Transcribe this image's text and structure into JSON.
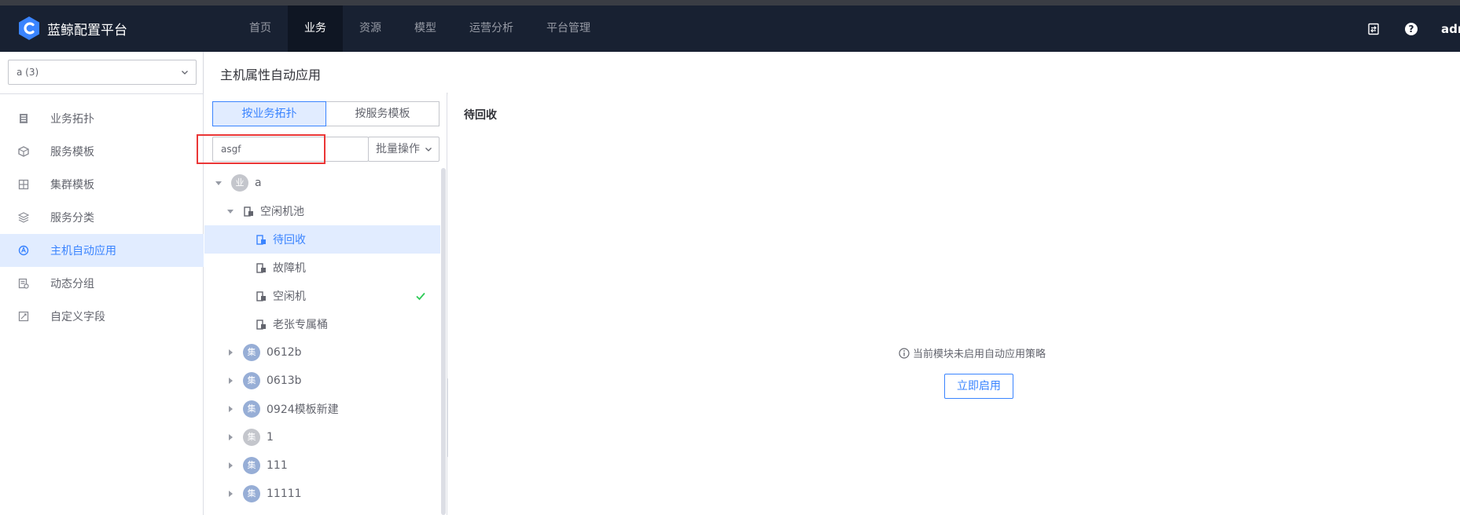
{
  "app": {
    "name": "蓝鲸配置平台"
  },
  "nav": {
    "items": [
      {
        "label": "首页"
      },
      {
        "label": "业务"
      },
      {
        "label": "资源"
      },
      {
        "label": "模型"
      },
      {
        "label": "运营分析"
      },
      {
        "label": "平台管理"
      }
    ],
    "active": "业务",
    "user": "admin"
  },
  "sidebar": {
    "business_select": "a (3)",
    "items": [
      {
        "label": "业务拓扑",
        "icon": "server-stack-icon"
      },
      {
        "label": "服务模板",
        "icon": "cube-icon"
      },
      {
        "label": "集群模板",
        "icon": "cluster-icon"
      },
      {
        "label": "服务分类",
        "icon": "layers-icon"
      },
      {
        "label": "主机自动应用",
        "icon": "auto-apply-icon"
      },
      {
        "label": "动态分组",
        "icon": "dynamic-group-icon"
      },
      {
        "label": "自定义字段",
        "icon": "custom-field-icon"
      }
    ],
    "active": "主机自动应用"
  },
  "page": {
    "title": "主机属性自动应用"
  },
  "tree_panel": {
    "tabs": [
      {
        "label": "按业务拓扑"
      },
      {
        "label": "按服务模板"
      }
    ],
    "active_tab": "按业务拓扑",
    "search_value": "asgf",
    "batch_label": "批量操作",
    "nodes": [
      {
        "label": "a",
        "badge": "业",
        "expanded": true
      },
      {
        "label": "空闲机池",
        "expanded": true
      },
      {
        "label": "待回收",
        "selected": true
      },
      {
        "label": "故障机"
      },
      {
        "label": "空闲机",
        "checked": true
      },
      {
        "label": "老张专属桶"
      },
      {
        "label": "0612b",
        "badge": "集"
      },
      {
        "label": "0613b",
        "badge": "集"
      },
      {
        "label": "0924模板新建",
        "badge": "集"
      },
      {
        "label": "1",
        "badge": "集"
      },
      {
        "label": "111",
        "badge": "集"
      },
      {
        "label": "11111",
        "badge": "集"
      }
    ]
  },
  "detail": {
    "title": "待回收",
    "empty_message": "当前模块未启用自动应用策略",
    "enable_button": "立即启用"
  },
  "colors": {
    "nav_bg": "#182132",
    "accent": "#3a84ff",
    "success": "#2dcb56",
    "highlight_border": "#ea3636"
  }
}
